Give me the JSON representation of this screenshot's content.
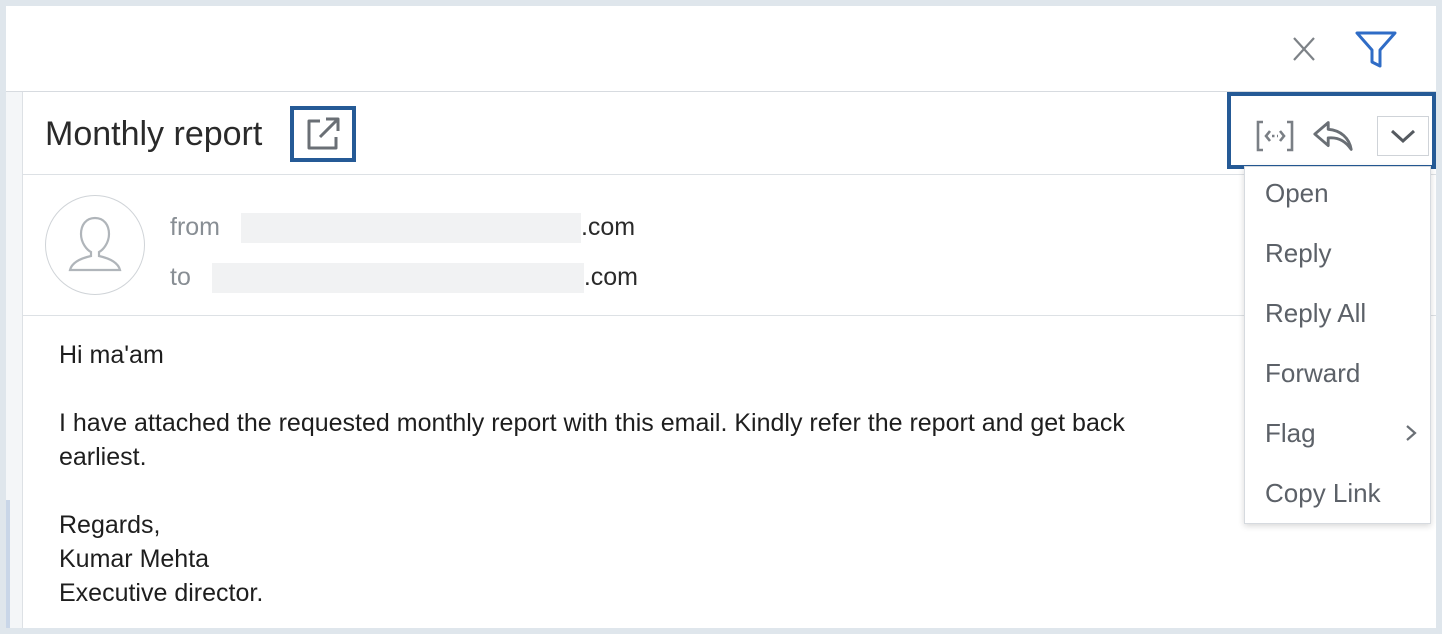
{
  "colors": {
    "accent": "#255a96",
    "filter_icon": "#2f6cc6",
    "text_primary": "#2a2a2a",
    "text_muted": "#888e94",
    "menu_text": "#5c6168"
  },
  "topbar": {
    "close_icon": "close-icon",
    "filter_icon": "filter-icon"
  },
  "email": {
    "subject": "Monthly report",
    "popout_icon": "open-in-new-window-icon",
    "from_label": "from",
    "from_suffix": ".com",
    "to_label": "to",
    "to_suffix": ".com",
    "body": {
      "greeting": "Hi ma'am",
      "paragraph_line1": "I have attached the requested monthly report with this email. Kindly refer the report and get back",
      "paragraph_line2": "earliest.",
      "sign_off": "Regards,",
      "name": "Kumar Mehta",
      "title": "Executive director."
    }
  },
  "actions": {
    "expand_icon": "expand-icon",
    "reply_icon": "reply-icon",
    "more_icon": "chevron-down-icon"
  },
  "dropdown": {
    "items": [
      {
        "label": "Open"
      },
      {
        "label": "Reply"
      },
      {
        "label": "Reply All"
      },
      {
        "label": "Forward"
      },
      {
        "label": "Flag",
        "has_submenu": true
      },
      {
        "label": "Copy Link"
      }
    ]
  }
}
